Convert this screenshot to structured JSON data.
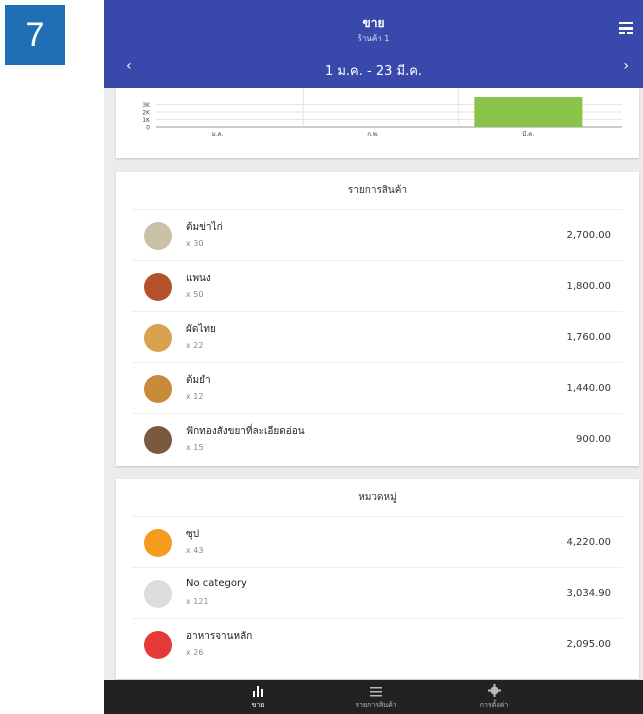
{
  "step_badge": "7",
  "header": {
    "title": "ขาย",
    "subtitle": "ร้านค้า 1",
    "date_range": "1 ม.ค. - 23 มี.ค.",
    "prev_icon": "chevron-left-icon",
    "next_icon": "chevron-right-icon",
    "menu_icon": "drawer-icon"
  },
  "chart_data": {
    "type": "bar",
    "categories": [
      "ม.ค.",
      "ก.พ.",
      "มี.ค."
    ],
    "values": [
      0,
      0,
      4000
    ],
    "y_ticks": [
      "3K",
      "2K",
      "1K",
      "0"
    ],
    "ylim": [
      0,
      4000
    ],
    "bar_color": "#8bc34a",
    "grid": true
  },
  "products": {
    "heading": "รายการสินค้า",
    "items": [
      {
        "name": "ต้มข่าไก่",
        "qty": "x 30",
        "amount": "2,700.00",
        "color": "#c9c1a8"
      },
      {
        "name": "แพนง",
        "qty": "x 50",
        "amount": "1,800.00",
        "color": "#b5512a"
      },
      {
        "name": "ผัดไทย",
        "qty": "x 22",
        "amount": "1,760.00",
        "color": "#d8a24e"
      },
      {
        "name": "ต้มยำ",
        "qty": "x 12",
        "amount": "1,440.00",
        "color": "#c98a3a"
      },
      {
        "name": "ฟักทองสังขยาที่ละเอียดอ่อน",
        "qty": "x 15",
        "amount": "900.00",
        "color": "#7a5a3e"
      }
    ]
  },
  "categories": {
    "heading": "หมวดหมู่",
    "items": [
      {
        "name": "ซุป",
        "qty": "x 43",
        "amount": "4,220.00",
        "color": "#f39c1f"
      },
      {
        "name": "No category",
        "qty": "x 121",
        "amount": "3,034.90",
        "color": "#dcdcdc"
      },
      {
        "name": "อาหารจานหลัก",
        "qty": "x 26",
        "amount": "2,095.00",
        "color": "#e53935"
      }
    ]
  },
  "nav": {
    "sales": "ขาย",
    "items": "รายการสินค้า",
    "settings": "การตั้งค่า"
  }
}
